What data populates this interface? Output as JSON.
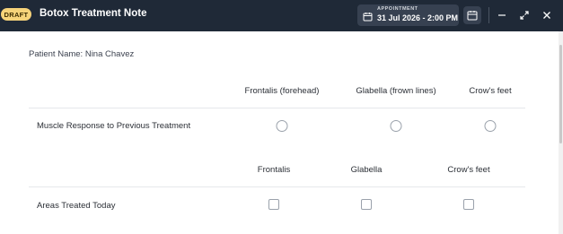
{
  "window": {
    "status_badge": "DRAFT",
    "title": "Botox Treatment Note"
  },
  "appointment": {
    "label": "APPOINTMENT",
    "value": "31 Jul 2026 - 2:00 PM"
  },
  "icons": {
    "appointment": "calendar-icon",
    "calendar_button": "calendar-icon",
    "minimize": "minimize-icon",
    "maximize": "expand-icon",
    "close": "close-icon"
  },
  "patient": {
    "label": "Patient Name: Nina Chavez"
  },
  "muscle_response": {
    "columns": [
      "Frontalis (forehead)",
      "Glabella (frown lines)",
      "Crow's feet"
    ],
    "row_label": "Muscle Response to Previous Treatment",
    "control": "radio",
    "selected": [
      false,
      false,
      false
    ]
  },
  "areas_treated": {
    "columns": [
      "Frontalis",
      "Glabella",
      "Crow's feet"
    ],
    "row_label": "Areas Treated Today",
    "control": "checkbox",
    "checked": [
      false,
      false,
      false
    ]
  },
  "colors": {
    "titlebar": "#1f2937",
    "badge": "#f6d37a",
    "button_bg": "#374151"
  }
}
